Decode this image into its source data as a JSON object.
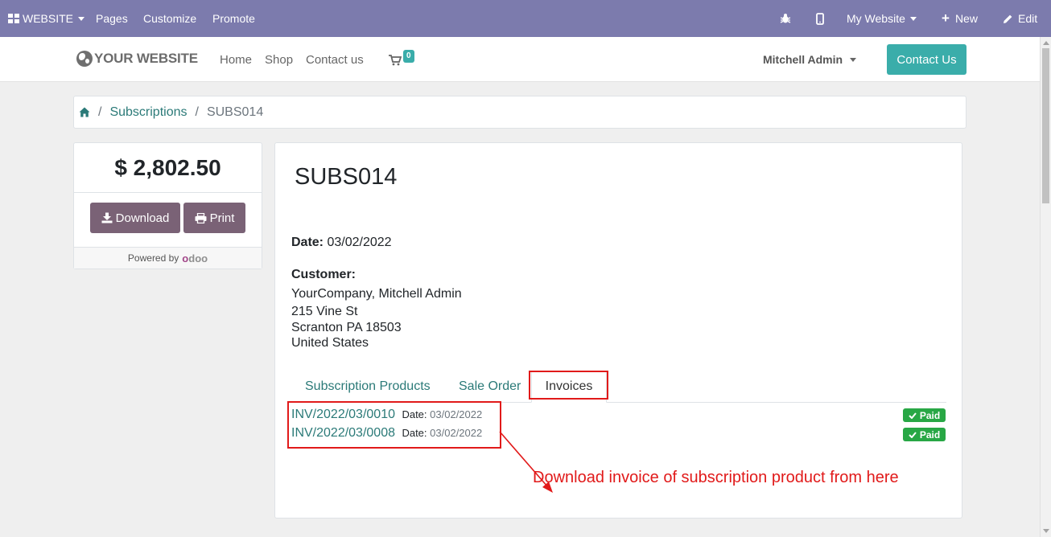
{
  "admin_bar": {
    "website_menu": "WEBSITE",
    "pages": "Pages",
    "customize": "Customize",
    "promote": "Promote",
    "my_website": "My Website",
    "new": "New",
    "edit": "Edit",
    "color": "#7c7bad"
  },
  "header": {
    "logo_text": "YOUR WEBSITE",
    "nav": [
      "Home",
      "Shop",
      "Contact us"
    ],
    "cart_count": "0",
    "user": "Mitchell Admin",
    "contact_button": "Contact Us",
    "accent_color": "#3aadaa"
  },
  "breadcrumb": {
    "sep": "/",
    "subscriptions": "Subscriptions",
    "current": "SUBS014"
  },
  "summary": {
    "amount": "$ 2,802.50",
    "download": "Download",
    "print": "Print",
    "powered_by": "Powered by",
    "odoo_o": "o",
    "odoo_rest": "doo"
  },
  "subscription": {
    "title": "SUBS014",
    "date_label": "Date:",
    "date": "03/02/2022",
    "customer_label": "Customer:",
    "customer_name": "YourCompany, Mitchell Admin",
    "address_line1": "215 Vine St",
    "address_line2": "Scranton PA 18503",
    "address_line3": "United States"
  },
  "tabs": [
    "Subscription Products",
    "Sale Order",
    "Invoices"
  ],
  "invoices": [
    {
      "number": "INV/2022/03/0010",
      "date_label": "Date:",
      "date": "03/02/2022",
      "status": "Paid"
    },
    {
      "number": "INV/2022/03/0008",
      "date_label": "Date:",
      "date": "03/02/2022",
      "status": "Paid"
    }
  ],
  "annotation": "Download invoice of subscription product from here",
  "colors": {
    "annotation": "#e11a1a",
    "paid_badge": "#28a745",
    "button_dark": "#7a6276",
    "link": "#2b7a78"
  }
}
